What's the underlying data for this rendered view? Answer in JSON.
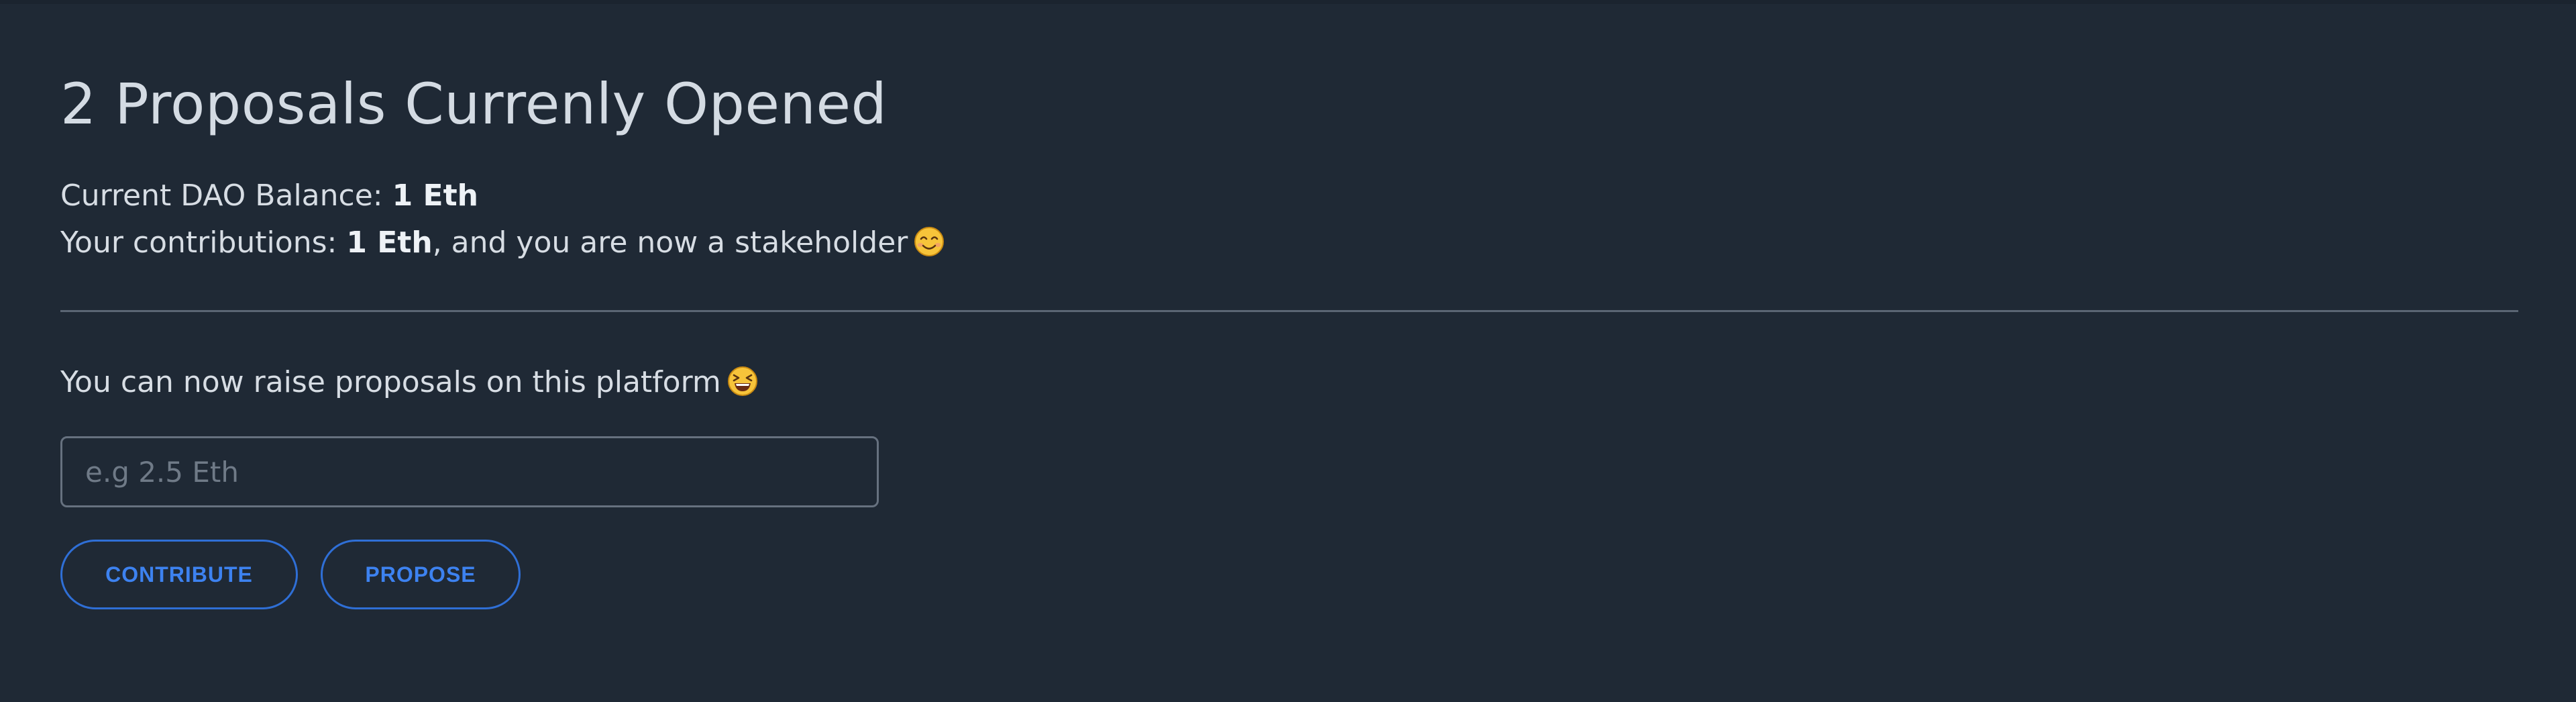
{
  "header": {
    "title": "2 Proposals Currenly Opened"
  },
  "stats": {
    "balance_label": "Current DAO Balance:",
    "balance_value": "1 Eth",
    "contrib_label": "Your contributions:",
    "contrib_value": "1 Eth",
    "contrib_suffix": ", and you are now a stakeholder",
    "contrib_emoji_icon": "smiling-face-icon"
  },
  "proposal_form": {
    "message": "You can now raise proposals on this platform",
    "message_emoji_icon": "grinning-squinting-face-icon",
    "amount_placeholder": "e.g 2.5 Eth",
    "amount_value": "",
    "contribute_label": "CONTRIBUTE",
    "propose_label": "PROPOSE"
  },
  "colors": {
    "background": "#1f2935",
    "accent": "#3d82f0",
    "text": "#d7dde4"
  }
}
